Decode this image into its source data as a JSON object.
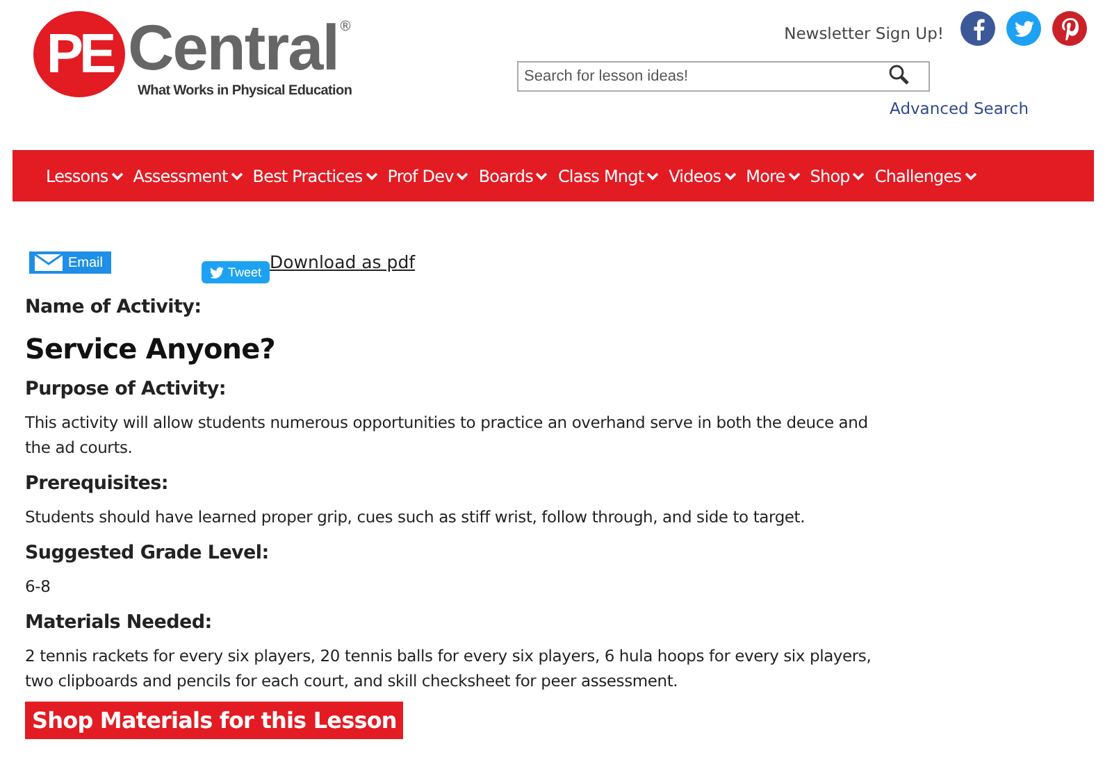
{
  "logo": {
    "mark": "PE",
    "word": "Central",
    "registered": "®",
    "tagline": "What Works in Physical Education"
  },
  "header": {
    "newsletter": "Newsletter Sign Up!",
    "search": {
      "placeholder": "Search for lesson ideas!"
    },
    "advanced_search": "Advanced Search"
  },
  "nav": [
    "Lessons",
    "Assessment",
    "Best Practices",
    "Prof Dev",
    "Boards",
    "Class Mngt",
    "Videos",
    "More",
    "Shop",
    "Challenges"
  ],
  "share": {
    "email": "Email",
    "tweet": "Tweet",
    "download": "Download as pdf"
  },
  "sections": [
    {
      "heading": "Name of Activity:",
      "body": "Service Anyone?",
      "kind": "title"
    },
    {
      "heading": "Purpose of Activity:",
      "body": "This activity will allow students numerous opportunities to practice an overhand serve in both the deuce and the ad courts.",
      "kind": "text"
    },
    {
      "heading": "Prerequisites:",
      "body": "Students should have learned proper grip, cues such as stiff wrist, follow through, and side to target.",
      "kind": "text"
    },
    {
      "heading": "Suggested Grade Level:",
      "body": "6-8",
      "kind": "text"
    },
    {
      "heading": "Materials Needed:",
      "body": "2 tennis rackets for every six players, 20 tennis balls for every six players, 6 hula hoops for every six players, two clipboards and pencils for each court, and skill checksheet for peer assessment.",
      "kind": "text"
    }
  ],
  "shop_button": "Shop Materials for this Lesson"
}
